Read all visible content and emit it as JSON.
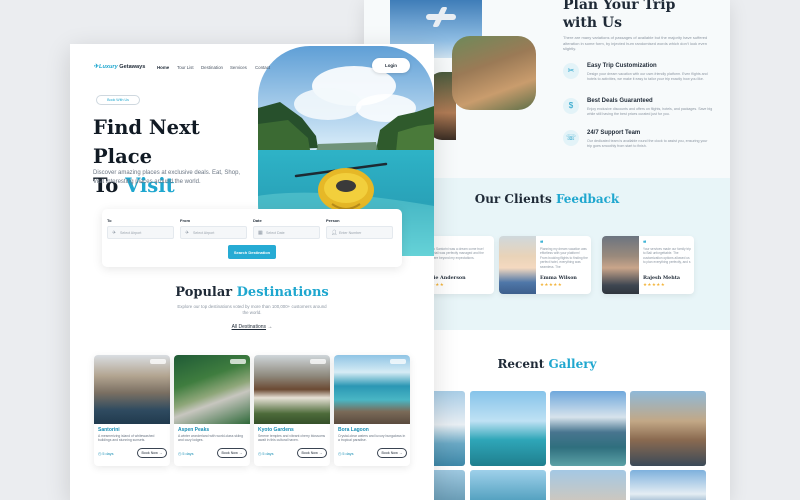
{
  "brand": {
    "name_part1": "Luxury",
    "name_part2": " Getaways",
    "accent_color": "#1fa7cf"
  },
  "nav": {
    "items": [
      "Home",
      "Tour List",
      "Destination",
      "Services",
      "Contact"
    ],
    "login_label": "Login"
  },
  "hero": {
    "pill": "Book With Us",
    "title_line1": "Find Next Place",
    "title_line2_prefix": "To ",
    "title_line2_accent": "Visit",
    "description": "Discover amazing places at exclusive deals. Eat, Shop, Visit interesting places around the world."
  },
  "search": {
    "fields": [
      {
        "label": "To",
        "placeholder": "Select Airport",
        "icon": "plane-icon"
      },
      {
        "label": "From",
        "placeholder": "Select Airport",
        "icon": "plane-icon"
      },
      {
        "label": "Date",
        "placeholder": "Select Date",
        "icon": "calendar-icon"
      },
      {
        "label": "Person",
        "placeholder": "Enter Number",
        "icon": "user-icon"
      }
    ],
    "button_label": "Search Destination"
  },
  "popular": {
    "title_prefix": "Popular ",
    "title_accent": "Destinations",
    "description": "Explore our top destinations voted by more than 100,000+ customers around the world.",
    "all_link": "All Destinations",
    "arrow": "→"
  },
  "cards": [
    {
      "title": "Santorini",
      "description": "A mesmerizing island of whitewashed buildings and stunning sunsets.",
      "days": "5 days",
      "book_label": "Book Now →"
    },
    {
      "title": "Aspen Peaks",
      "description": "A winter wonderland with world-class skiing and cozy lodges.",
      "days": "5 days",
      "book_label": "Book Now →"
    },
    {
      "title": "Kyoto Gardens",
      "description": "Serene temples and vibrant cherry blossoms await in this cultural haven.",
      "days": "5 days",
      "book_label": "Book Now →"
    },
    {
      "title": "Bora Lagoon",
      "description": "Crystal-clear waters and luxury bungalows in a tropical paradise.",
      "days": "5 days",
      "book_label": "Book Now →"
    }
  ],
  "plan": {
    "title_line1": "Plan Your Trip",
    "title_line2": "with Us",
    "description": "There are many variations of passages of available but the majority have suffered alteration in some form, by injected hum randomised words which don't look even slightly.",
    "features": [
      {
        "icon": "tools-icon",
        "glyph": "✂",
        "title": "Easy Trip Customization",
        "description": "Design your dream vacation with our user-friendly platform. Even flights and hotels to activities, we make it easy to tailor your trip exactly how you like."
      },
      {
        "icon": "dollar-icon",
        "glyph": "$",
        "title": "Best Deals Guaranteed",
        "description": "Enjoy exclusive discounts and offers on flights, hotels, and packages. Save big while still having the best prices curated just for you."
      },
      {
        "icon": "support-icon",
        "glyph": "☏",
        "title": "24/7 Support Team",
        "description": "Our dedicated team is available round the clock to assist you, ensuring your trip goes smoothly from start to finish."
      }
    ]
  },
  "feedback": {
    "title_prefix": "Our Clients ",
    "title_accent": "Feedback",
    "reviews": [
      {
        "name": "Sophie Anderson",
        "text": "My trip to Santorini was a dream come true! Every detail was perfectly managed and the hotels were beyond my expectations.",
        "stars": "★★★★★"
      },
      {
        "name": "Emma Wilson",
        "text": "Planning my dream vacation was effortless with your platform! From booking flights to finding the perfect hotel, everything was seamless. The",
        "stars": "★★★★★"
      },
      {
        "name": "Rajesh Mehta",
        "text": "Your services made our family trip to Bali unforgettable. The customization options allowed us to plan everything perfectly, and s",
        "stars": "★★★★★"
      }
    ]
  },
  "gallery": {
    "title_prefix": "Recent ",
    "title_accent": "Gallery"
  }
}
